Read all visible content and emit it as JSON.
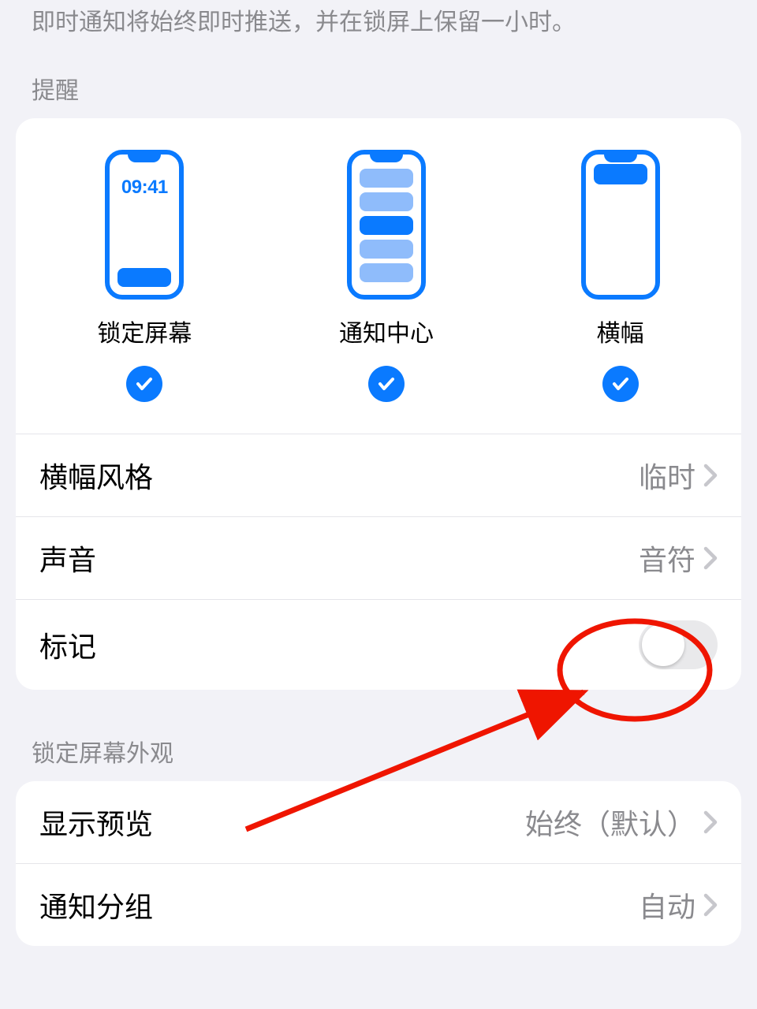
{
  "description": "即时通知将始终即时推送，并在锁屏上保留一小时。",
  "sections": {
    "alerts": {
      "header": "提醒",
      "lock_screen": {
        "label": "锁定屏幕",
        "time": "09:41",
        "checked": true
      },
      "notification_center": {
        "label": "通知中心",
        "checked": true
      },
      "banners": {
        "label": "横幅",
        "checked": true
      },
      "banner_style": {
        "label": "横幅风格",
        "value": "临时"
      },
      "sounds": {
        "label": "声音",
        "value": "音符"
      },
      "badges": {
        "label": "标记",
        "on": false
      }
    },
    "appearance": {
      "header": "锁定屏幕外观",
      "show_previews": {
        "label": "显示预览",
        "value": "始终（默认）"
      },
      "grouping": {
        "label": "通知分组",
        "value": "自动"
      }
    }
  }
}
